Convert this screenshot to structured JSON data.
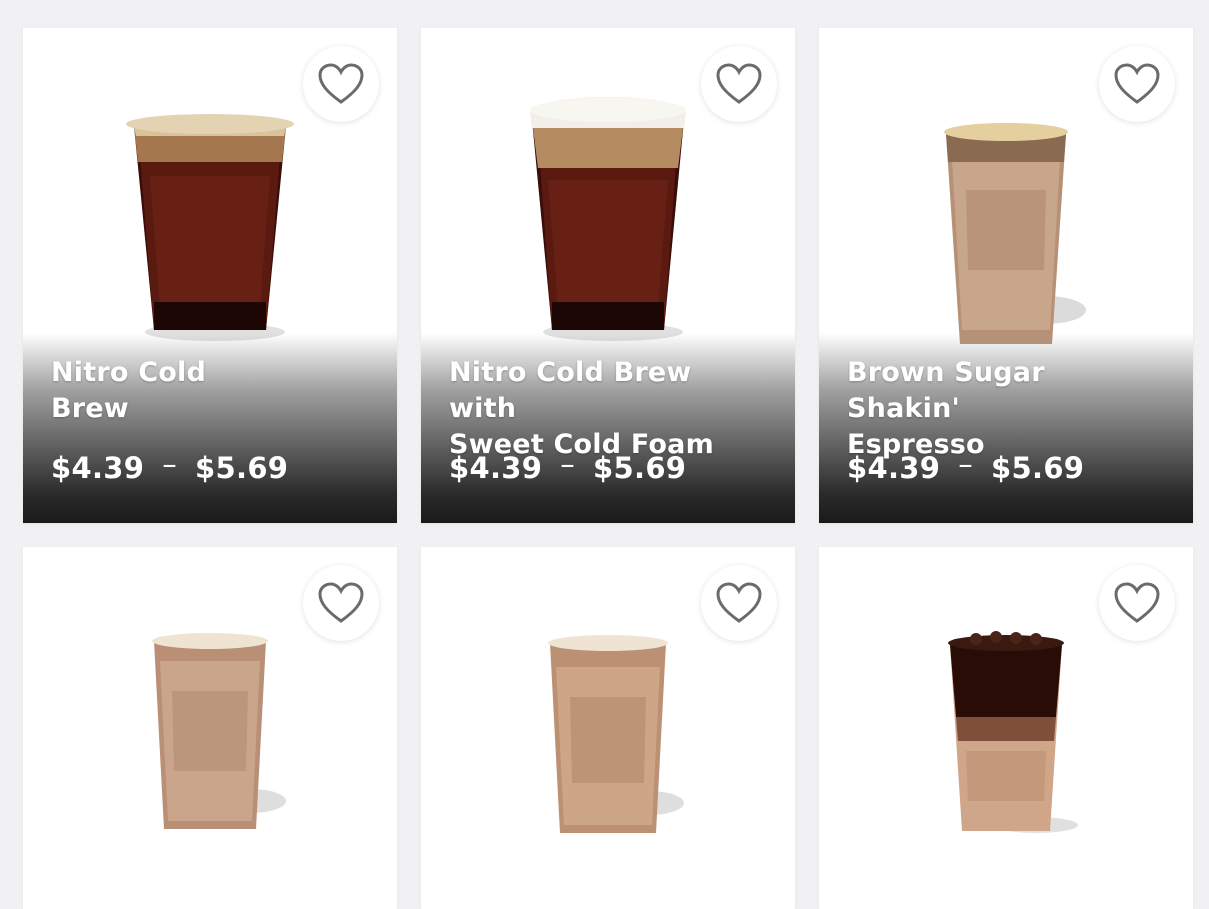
{
  "products": [
    {
      "name_line1": "Nitro Cold",
      "name_line2": "Brew",
      "price_low": "$4.39",
      "price_sep": "–",
      "price_high": "$5.69",
      "drink": "nitro-cold-brew"
    },
    {
      "name_line1": "Nitro Cold Brew with",
      "name_line2": "Sweet Cold Foam",
      "price_low": "$4.39",
      "price_sep": "–",
      "price_high": "$5.69",
      "drink": "nitro-cold-brew-foam"
    },
    {
      "name_line1": "Brown Sugar Shakin'",
      "name_line2": "Espresso",
      "price_low": "$4.39",
      "price_sep": "–",
      "price_high": "$5.69",
      "drink": "brown-sugar-shaken-espresso"
    },
    {
      "drink": "iced-shaken-espresso-light"
    },
    {
      "drink": "iced-shaken-espresso-oat"
    },
    {
      "drink": "iced-latte-macchiato"
    }
  ],
  "icons": {
    "favorite": "heart-outline-icon"
  },
  "colors": {
    "heart": "#6b6b6b",
    "card": "#ffffff",
    "background": "#f1f1f3"
  }
}
